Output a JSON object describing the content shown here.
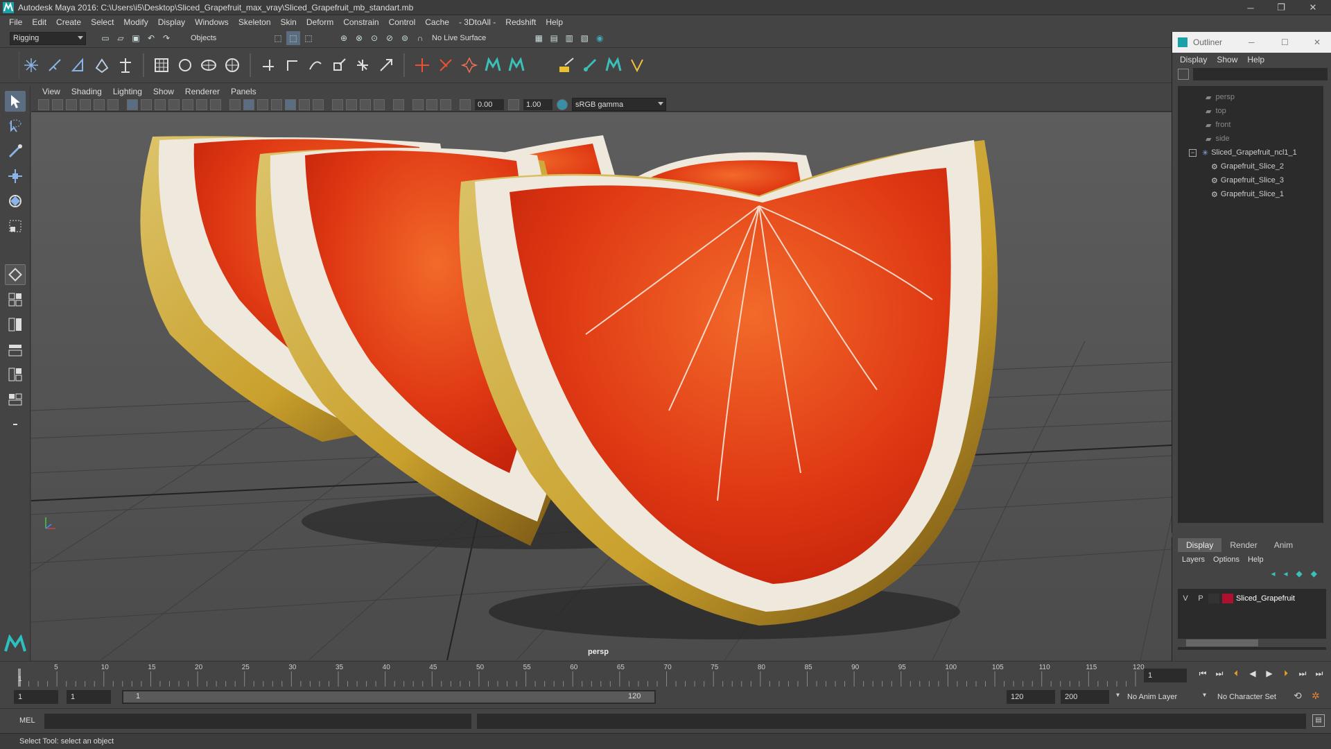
{
  "window": {
    "title": "Autodesk Maya 2016: C:\\Users\\i5\\Desktop\\Sliced_Grapefruit_max_vray\\Sliced_Grapefruit_mb_standart.mb"
  },
  "menubar": [
    "File",
    "Edit",
    "Create",
    "Select",
    "Modify",
    "Display",
    "Windows",
    "Skeleton",
    "Skin",
    "Deform",
    "Constrain",
    "Control",
    "Cache",
    "- 3DtoAll -",
    "Redshift",
    "Help"
  ],
  "statusline": {
    "menuset": "Rigging",
    "selection_mode": "Objects",
    "live_surface": "No Live Surface"
  },
  "viewport": {
    "menu": [
      "View",
      "Shading",
      "Lighting",
      "Show",
      "Renderer",
      "Panels"
    ],
    "exposure": "0.00",
    "gamma": "1.00",
    "color_space": "sRGB gamma",
    "camera_label": "persp"
  },
  "outliner": {
    "title": "Outliner",
    "menu": [
      "Display",
      "Show",
      "Help"
    ],
    "items": [
      {
        "label": "persp",
        "dim": true
      },
      {
        "label": "top",
        "dim": true
      },
      {
        "label": "front",
        "dim": true
      },
      {
        "label": "side",
        "dim": true
      },
      {
        "label": "Sliced_Grapefruit_ncl1_1",
        "dim": false
      },
      {
        "label": "Grapefruit_Slice_2",
        "dim": false
      },
      {
        "label": "Grapefruit_Slice_3",
        "dim": false
      },
      {
        "label": "Grapefruit_Slice_1",
        "dim": false
      }
    ]
  },
  "layers": {
    "tabs": [
      "Display",
      "Render",
      "Anim"
    ],
    "menu": [
      "Layers",
      "Options",
      "Help"
    ],
    "row": {
      "v": "V",
      "p": "P",
      "name": "Sliced_Grapefruit",
      "color": "#b01030"
    }
  },
  "timeline": {
    "ticks": [
      "5",
      "10",
      "15",
      "20",
      "25",
      "30",
      "35",
      "40",
      "45",
      "50",
      "55",
      "60",
      "65",
      "70",
      "75",
      "80",
      "85",
      "90",
      "95",
      "100",
      "105",
      "110",
      "115",
      "120"
    ],
    "start_label": "1",
    "current_frame": "1"
  },
  "range": {
    "start": "1",
    "playback_start": "1",
    "slider_start": "1",
    "slider_end": "120",
    "playback_end": "120",
    "end": "200",
    "anim_layer": "No Anim Layer",
    "character_set": "No Character Set"
  },
  "cmdline": {
    "label": "MEL"
  },
  "helpline": {
    "text": "Select Tool: select an object"
  }
}
